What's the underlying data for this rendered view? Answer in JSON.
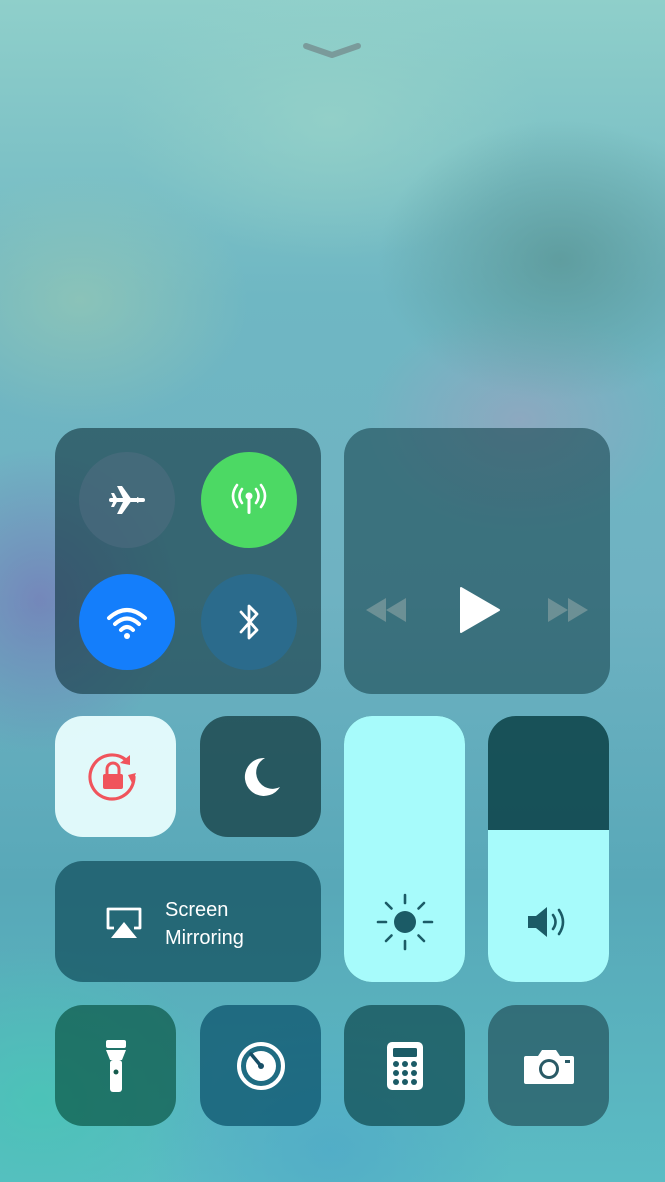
{
  "control_center": {
    "connectivity": {
      "airplane_mode": {
        "icon": "airplane-icon",
        "state": "off"
      },
      "cellular_data": {
        "icon": "cellular-antenna-icon",
        "state": "on",
        "color": "#4cd964"
      },
      "wifi": {
        "icon": "wifi-icon",
        "state": "on",
        "color": "#147efb"
      },
      "bluetooth": {
        "icon": "bluetooth-icon",
        "state": "off"
      }
    },
    "now_playing": {
      "rewind_icon": "rewind-icon",
      "play_icon": "play-icon",
      "fast_forward_icon": "fast-forward-icon"
    },
    "orientation_lock": {
      "icon": "rotation-lock-icon",
      "state": "on",
      "color": "#f0545c"
    },
    "do_not_disturb": {
      "icon": "moon-icon",
      "state": "off"
    },
    "screen_mirroring": {
      "icon": "airplay-icon",
      "label_line1": "Screen",
      "label_line2": "Mirroring"
    },
    "brightness": {
      "icon": "sun-icon",
      "level": 1.0
    },
    "volume": {
      "icon": "speaker-icon",
      "level": 0.57
    },
    "shortcuts": [
      {
        "name": "flashlight",
        "icon": "flashlight-icon"
      },
      {
        "name": "timer",
        "icon": "timer-icon"
      },
      {
        "name": "calculator",
        "icon": "calculator-icon"
      },
      {
        "name": "camera",
        "icon": "camera-icon"
      }
    ],
    "colors": {
      "slider_fill": "#a7fbfb",
      "tile_bg": "rgba(20,55,65,0.62)"
    }
  }
}
